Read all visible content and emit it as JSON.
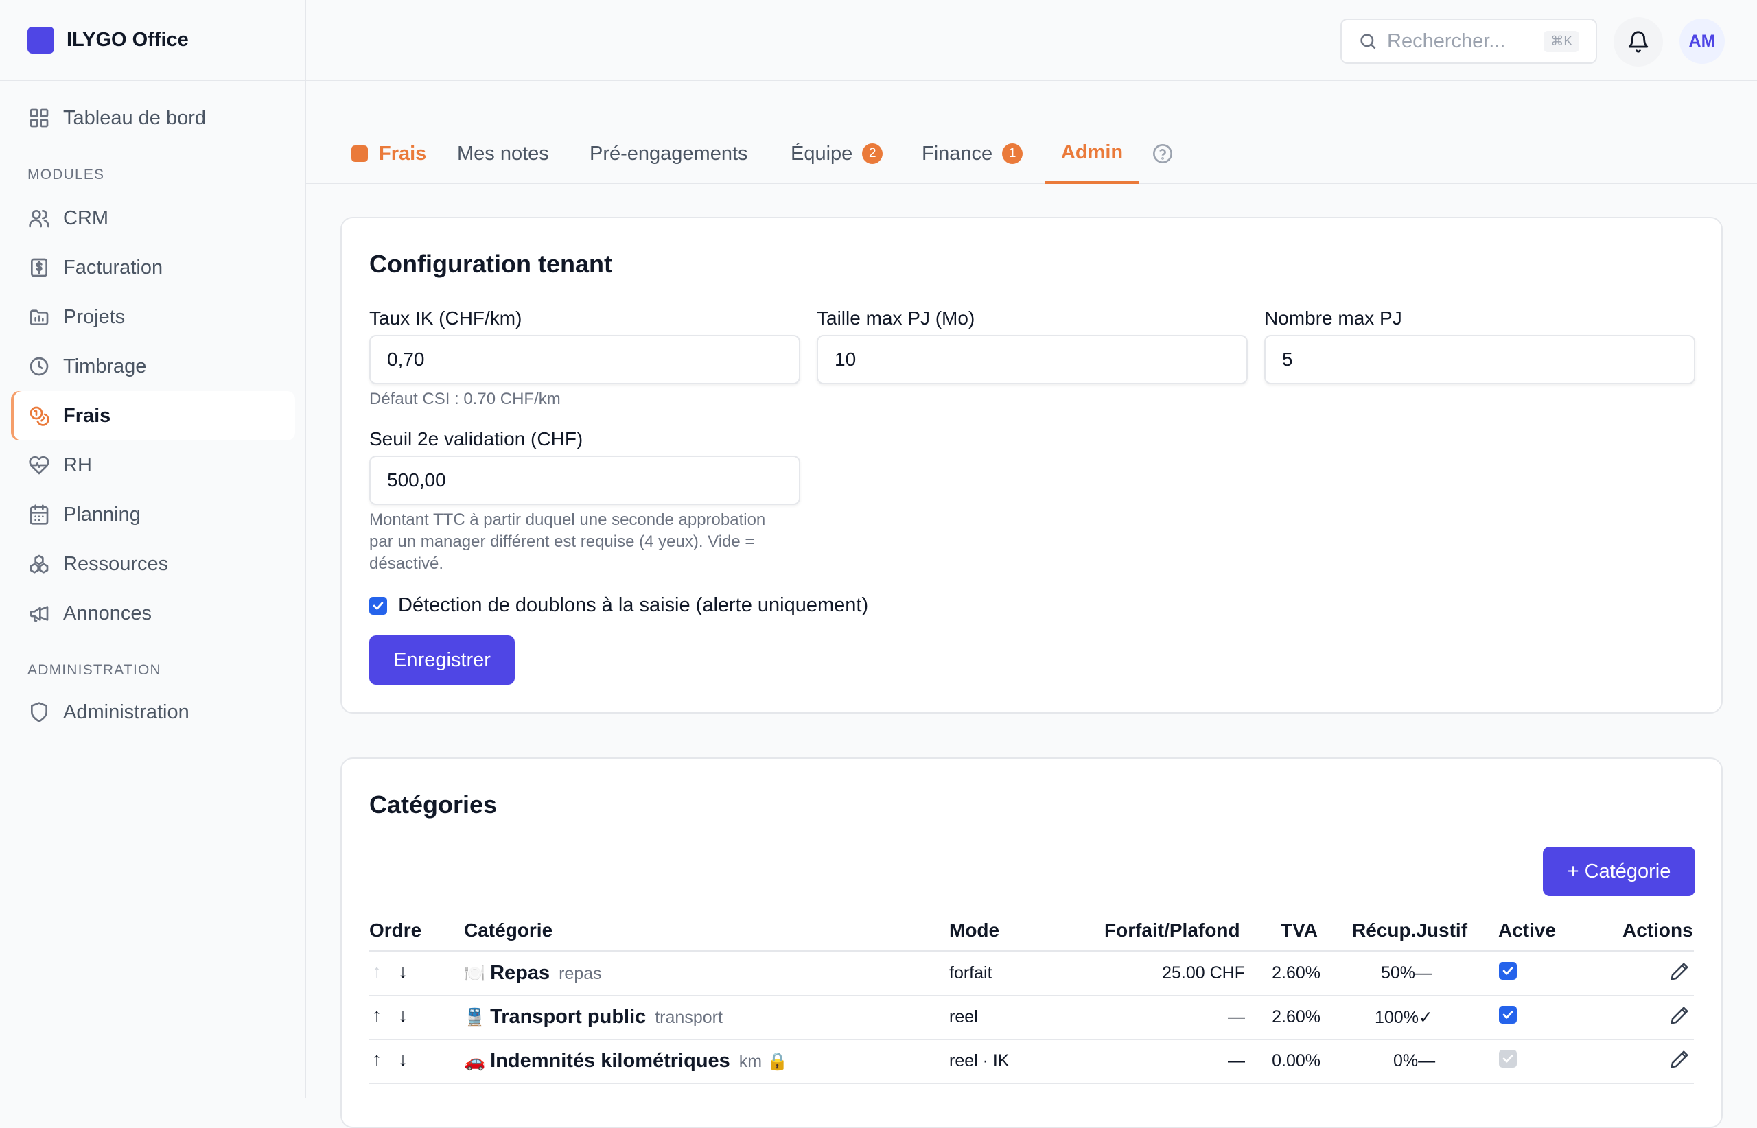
{
  "app": {
    "name": "ILYGO Office"
  },
  "sidebar": {
    "dashboard": "Tableau de bord",
    "modules_label": "MODULES",
    "items": [
      {
        "label": "CRM",
        "icon": "users-icon"
      },
      {
        "label": "Facturation",
        "icon": "invoice-icon"
      },
      {
        "label": "Projets",
        "icon": "folder-icon"
      },
      {
        "label": "Timbrage",
        "icon": "clock-icon"
      },
      {
        "label": "Frais",
        "icon": "coins-icon",
        "active": true
      },
      {
        "label": "RH",
        "icon": "heart-pulse-icon"
      },
      {
        "label": "Planning",
        "icon": "calendar-icon"
      },
      {
        "label": "Ressources",
        "icon": "boxes-icon"
      },
      {
        "label": "Annonces",
        "icon": "megaphone-icon"
      }
    ],
    "admin_label": "ADMINISTRATION",
    "administration": "Administration"
  },
  "topbar": {
    "search_placeholder": "Rechercher...",
    "shortcut": "⌘K",
    "avatar_initials": "AM"
  },
  "tabs": {
    "brand": "Frais",
    "items": [
      {
        "label": "Mes notes"
      },
      {
        "label": "Pré-engagements"
      },
      {
        "label": "Équipe",
        "badge": "2"
      },
      {
        "label": "Finance",
        "badge": "1"
      },
      {
        "label": "Admin",
        "active": true
      }
    ]
  },
  "config": {
    "title": "Configuration tenant",
    "taux_ik_label": "Taux IK (CHF/km)",
    "taux_ik_value": "0,70",
    "taux_ik_hint": "Défaut CSI : 0.70 CHF/km",
    "taille_label": "Taille max PJ (Mo)",
    "taille_value": "10",
    "nombre_label": "Nombre max PJ",
    "nombre_value": "5",
    "seuil_label": "Seuil 2e validation (CHF)",
    "seuil_value": "500,00",
    "seuil_hint_1": "Montant TTC à partir duquel une seconde approbation",
    "seuil_hint_2": "par un manager différent est requise (4 yeux). Vide =",
    "seuil_hint_3": "désactivé.",
    "doublons_label": "Détection de doublons à la saisie (alerte uniquement)",
    "doublons_checked": true,
    "save_label": "Enregistrer"
  },
  "categories": {
    "title": "Catégories",
    "add_label": "+ Catégorie",
    "headers": {
      "ordre": "Ordre",
      "categorie": "Catégorie",
      "mode": "Mode",
      "forfait": "Forfait/Plafond",
      "tva": "TVA",
      "recup": "Récup.Justif",
      "active": "Active",
      "actions": "Actions"
    },
    "rows": [
      {
        "emoji": "🍽️",
        "name": "Repas",
        "code": "repas",
        "mode": "forfait",
        "forfait": "25.00 CHF",
        "tva": "2.60%",
        "recup": "50%",
        "justif": "—",
        "active": true
      },
      {
        "emoji": "🚆",
        "name": "Transport public",
        "code": "transport",
        "mode": "reel",
        "forfait": "—",
        "tva": "2.60%",
        "recup": "100%",
        "justif": "✓",
        "active": true
      },
      {
        "emoji": "🚗",
        "name": "Indemnités kilométriques",
        "code": "km",
        "lock": "🔒",
        "mode": "reel · IK",
        "forfait": "—",
        "tva": "0.00%",
        "recup": "0%",
        "justif": "—",
        "active": true,
        "disabled": true
      }
    ]
  }
}
